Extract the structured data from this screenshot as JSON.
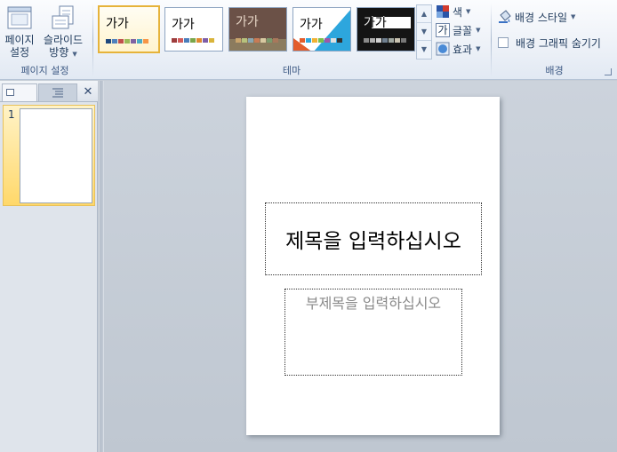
{
  "ribbon": {
    "page_setup_group": {
      "label": "페이지 설정",
      "page_setup_line1": "페이지",
      "page_setup_line2": "설정",
      "orientation_line1": "슬라이드",
      "orientation_line2": "방향"
    },
    "themes_group": {
      "label": "테마",
      "themes": [
        {
          "text": "가가",
          "bg": "#ffffff",
          "fg": "#000000"
        },
        {
          "text": "가가",
          "bg": "#ffffff",
          "fg": "#000000"
        },
        {
          "text": "가가",
          "bg": "#6b5147",
          "fg": "#e9d8c8"
        },
        {
          "text": "가가",
          "bg": "#ffffff",
          "fg": "#000000"
        },
        {
          "text": "가가",
          "bg": "#141414",
          "fg": "#ffffff"
        }
      ],
      "colors_label": "색",
      "fonts_label": "글꼴",
      "fonts_icon_text": "가",
      "effects_label": "효과"
    },
    "background_group": {
      "label": "배경",
      "background_styles_label": "배경 스타일",
      "hide_background_graphics_label": "배경 그래픽 숨기기"
    }
  },
  "slides_panel": {
    "slides": [
      {
        "number": "1"
      }
    ]
  },
  "slide": {
    "title_placeholder": "제목을 입력하십시오",
    "subtitle_placeholder": "부제목을 입력하십시오"
  },
  "colors": {
    "accent_selected": "#e6b33a",
    "ribbon_text": "#1e395b"
  }
}
